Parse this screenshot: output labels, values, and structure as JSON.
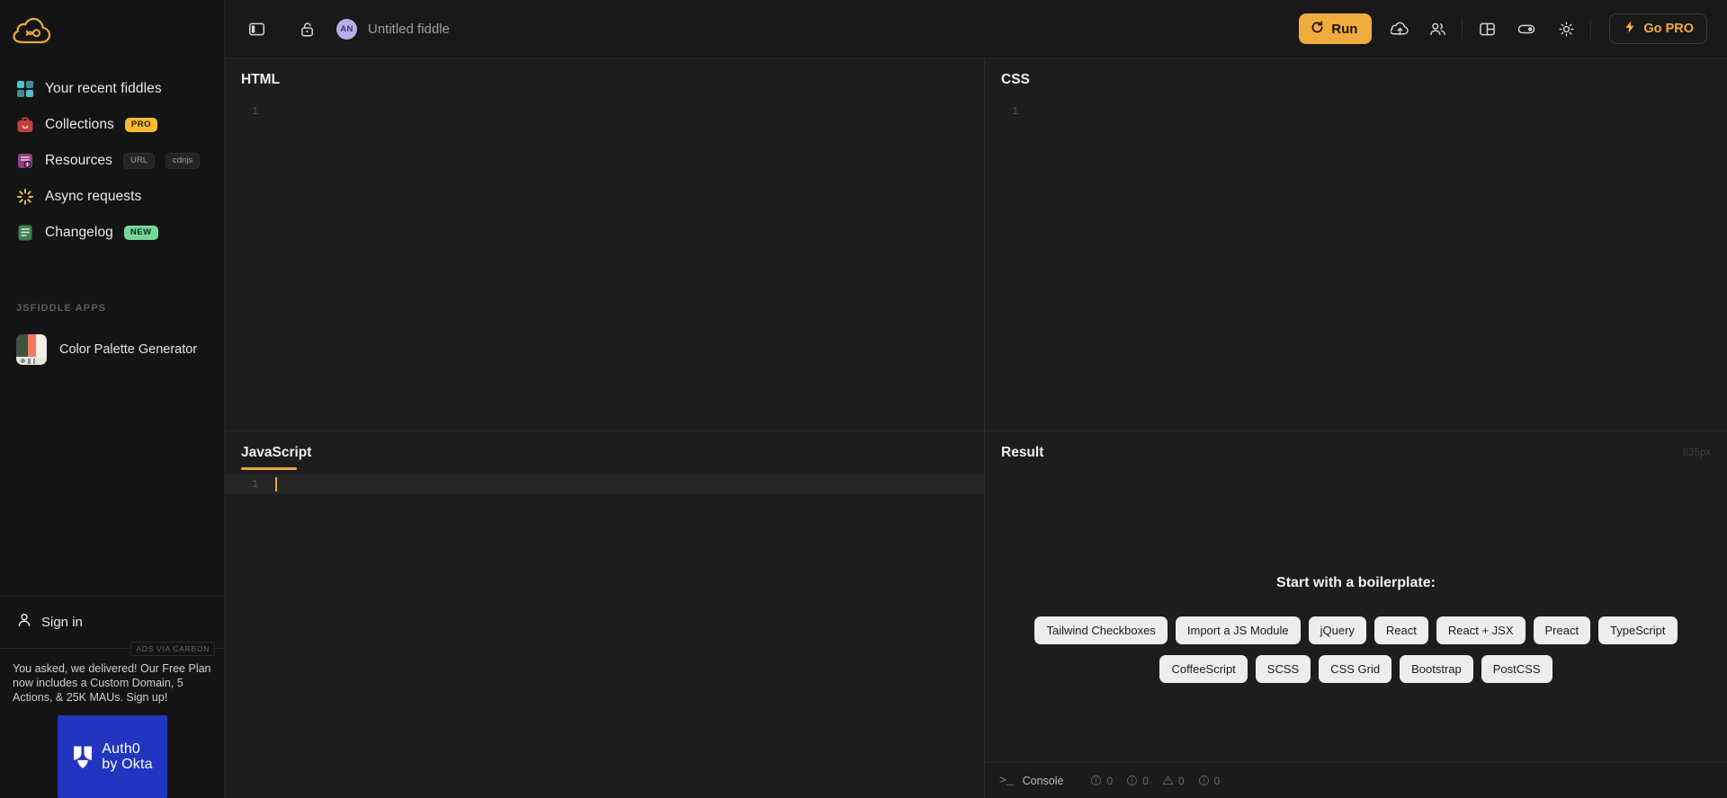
{
  "app": {
    "name": "JSFiddle",
    "logo_icon": "cloud-infinity-logo"
  },
  "sidebar": {
    "items": [
      {
        "label": "Your recent fiddles",
        "icon": "grid-squares-icon",
        "badges": []
      },
      {
        "label": "Collections",
        "icon": "briefcase-icon",
        "badges": [
          {
            "text": "PRO",
            "style": "pro"
          }
        ]
      },
      {
        "label": "Resources",
        "icon": "resources-icon",
        "badges": [
          {
            "text": "URL",
            "style": "plain"
          },
          {
            "text": "cdnjs",
            "style": "plain"
          }
        ]
      },
      {
        "label": "Async requests",
        "icon": "spinner-icon",
        "badges": []
      },
      {
        "label": "Changelog",
        "icon": "changelog-list-icon",
        "badges": [
          {
            "text": "NEW",
            "style": "new"
          }
        ]
      }
    ],
    "apps_section_title": "JSFIDDLE APPS",
    "apps": [
      {
        "label": "Color Palette Generator",
        "thumb_colors": [
          "#3f5243",
          "#f2795c",
          "#f3eee6"
        ]
      }
    ],
    "signin": {
      "label": "Sign in",
      "icon": "person-icon"
    },
    "ads": {
      "tag": "ADS VIA CARBON",
      "text": "You asked, we delivered! Our Free Plan now includes a Custom Domain, 5 Actions, & 25K MAUs. Sign up!",
      "image_line1": "Auth0",
      "image_line2": "by Okta",
      "image_bg": "#2235c0"
    }
  },
  "topbar": {
    "sidebar_toggle_icon": "panel-toggle-icon",
    "lock_icon": "unlock-icon",
    "avatar_initials": "AN",
    "fiddle_title": "Untitled fiddle",
    "run_label": "Run",
    "run_icon": "refresh-run-icon",
    "run_color": "#f0ac3c",
    "save_icon": "cloud-upload-icon",
    "collaborate_icon": "people-icon",
    "layout_icon": "layout-panel-icon",
    "toggle_icon": "toggle-switch-icon",
    "theme_icon": "brightness-sun-icon",
    "gopro_label": "Go PRO",
    "gopro_icon": "lightning-bolt-icon",
    "gopro_color": "#f0ac3c"
  },
  "panes": {
    "html": {
      "title": "HTML",
      "lines": [
        {
          "num": "1",
          "text": ""
        }
      ]
    },
    "css": {
      "title": "CSS",
      "lines": [
        {
          "num": "1",
          "text": ""
        }
      ]
    },
    "javascript": {
      "title": "JavaScript",
      "active": true,
      "lines": [
        {
          "num": "1",
          "text": ""
        }
      ]
    },
    "result": {
      "title": "Result",
      "width_label": "835px"
    }
  },
  "result": {
    "boilerplate_title": "Start with a boilerplate:",
    "rows": [
      [
        "Tailwind Checkboxes",
        "Import a JS Module",
        "jQuery",
        "React",
        "React + JSX",
        "Preact",
        "TypeScript"
      ],
      [
        "CoffeeScript",
        "SCSS",
        "CSS Grid",
        "Bootstrap",
        "PostCSS"
      ]
    ]
  },
  "console": {
    "prompt": ">_",
    "label": "Console",
    "counters": [
      {
        "icon": "info-circle-icon",
        "count": "0"
      },
      {
        "icon": "error-circle-icon",
        "count": "0"
      },
      {
        "icon": "warning-triangle-icon",
        "count": "0"
      },
      {
        "icon": "debug-circle-icon",
        "count": "0"
      }
    ]
  }
}
